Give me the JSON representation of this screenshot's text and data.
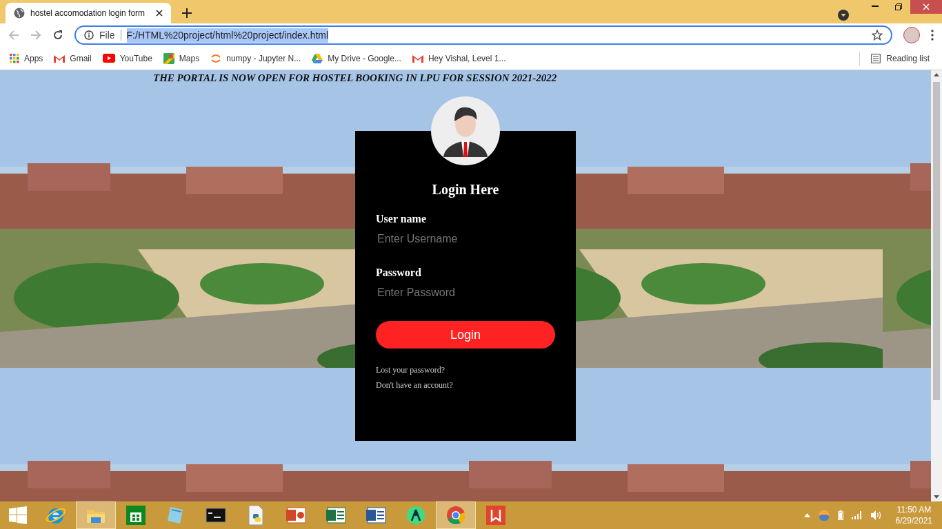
{
  "browser": {
    "tab": {
      "title": "hostel accomodation login form",
      "selected": true
    },
    "address": {
      "scheme": "File",
      "url": "F:/HTML%20project/html%20project/index.html"
    },
    "bookmarks": [
      {
        "kind": "apps",
        "label": "Apps"
      },
      {
        "kind": "gmail",
        "label": "Gmail"
      },
      {
        "kind": "youtube",
        "label": "YouTube"
      },
      {
        "kind": "maps",
        "label": "Maps"
      },
      {
        "kind": "jupyter",
        "label": "numpy - Jupyter N..."
      },
      {
        "kind": "drive",
        "label": "My Drive - Google..."
      },
      {
        "kind": "gmail",
        "label": "Hey Vishal, Level 1..."
      }
    ],
    "reading_list": "Reading list"
  },
  "page": {
    "notice": "THE PORTAL IS NOW OPEN FOR HOSTEL BOOKING IN LPU FOR SESSION 2021-2022",
    "login": {
      "title": "Login Here",
      "fields": [
        {
          "label": "User name",
          "placeholder": "Enter Username"
        },
        {
          "label": "Password",
          "placeholder": "Enter Password"
        }
      ],
      "button": "Login",
      "links": [
        "Lost your password?",
        "Don't have an account?"
      ]
    }
  },
  "taskbar": {
    "apps": [
      {
        "kind": "ie",
        "active": false
      },
      {
        "kind": "explorer",
        "active": true
      },
      {
        "kind": "store",
        "active": false
      },
      {
        "kind": "notepad",
        "active": false
      },
      {
        "kind": "terminal",
        "active": false
      },
      {
        "kind": "python",
        "active": false
      },
      {
        "kind": "powerpoint",
        "active": false
      },
      {
        "kind": "excel",
        "active": false
      },
      {
        "kind": "word",
        "active": false
      },
      {
        "kind": "android",
        "active": false
      },
      {
        "kind": "chrome",
        "active": true
      },
      {
        "kind": "pdf",
        "active": false
      }
    ],
    "time": "11:50 AM",
    "date": "6/29/2021"
  }
}
